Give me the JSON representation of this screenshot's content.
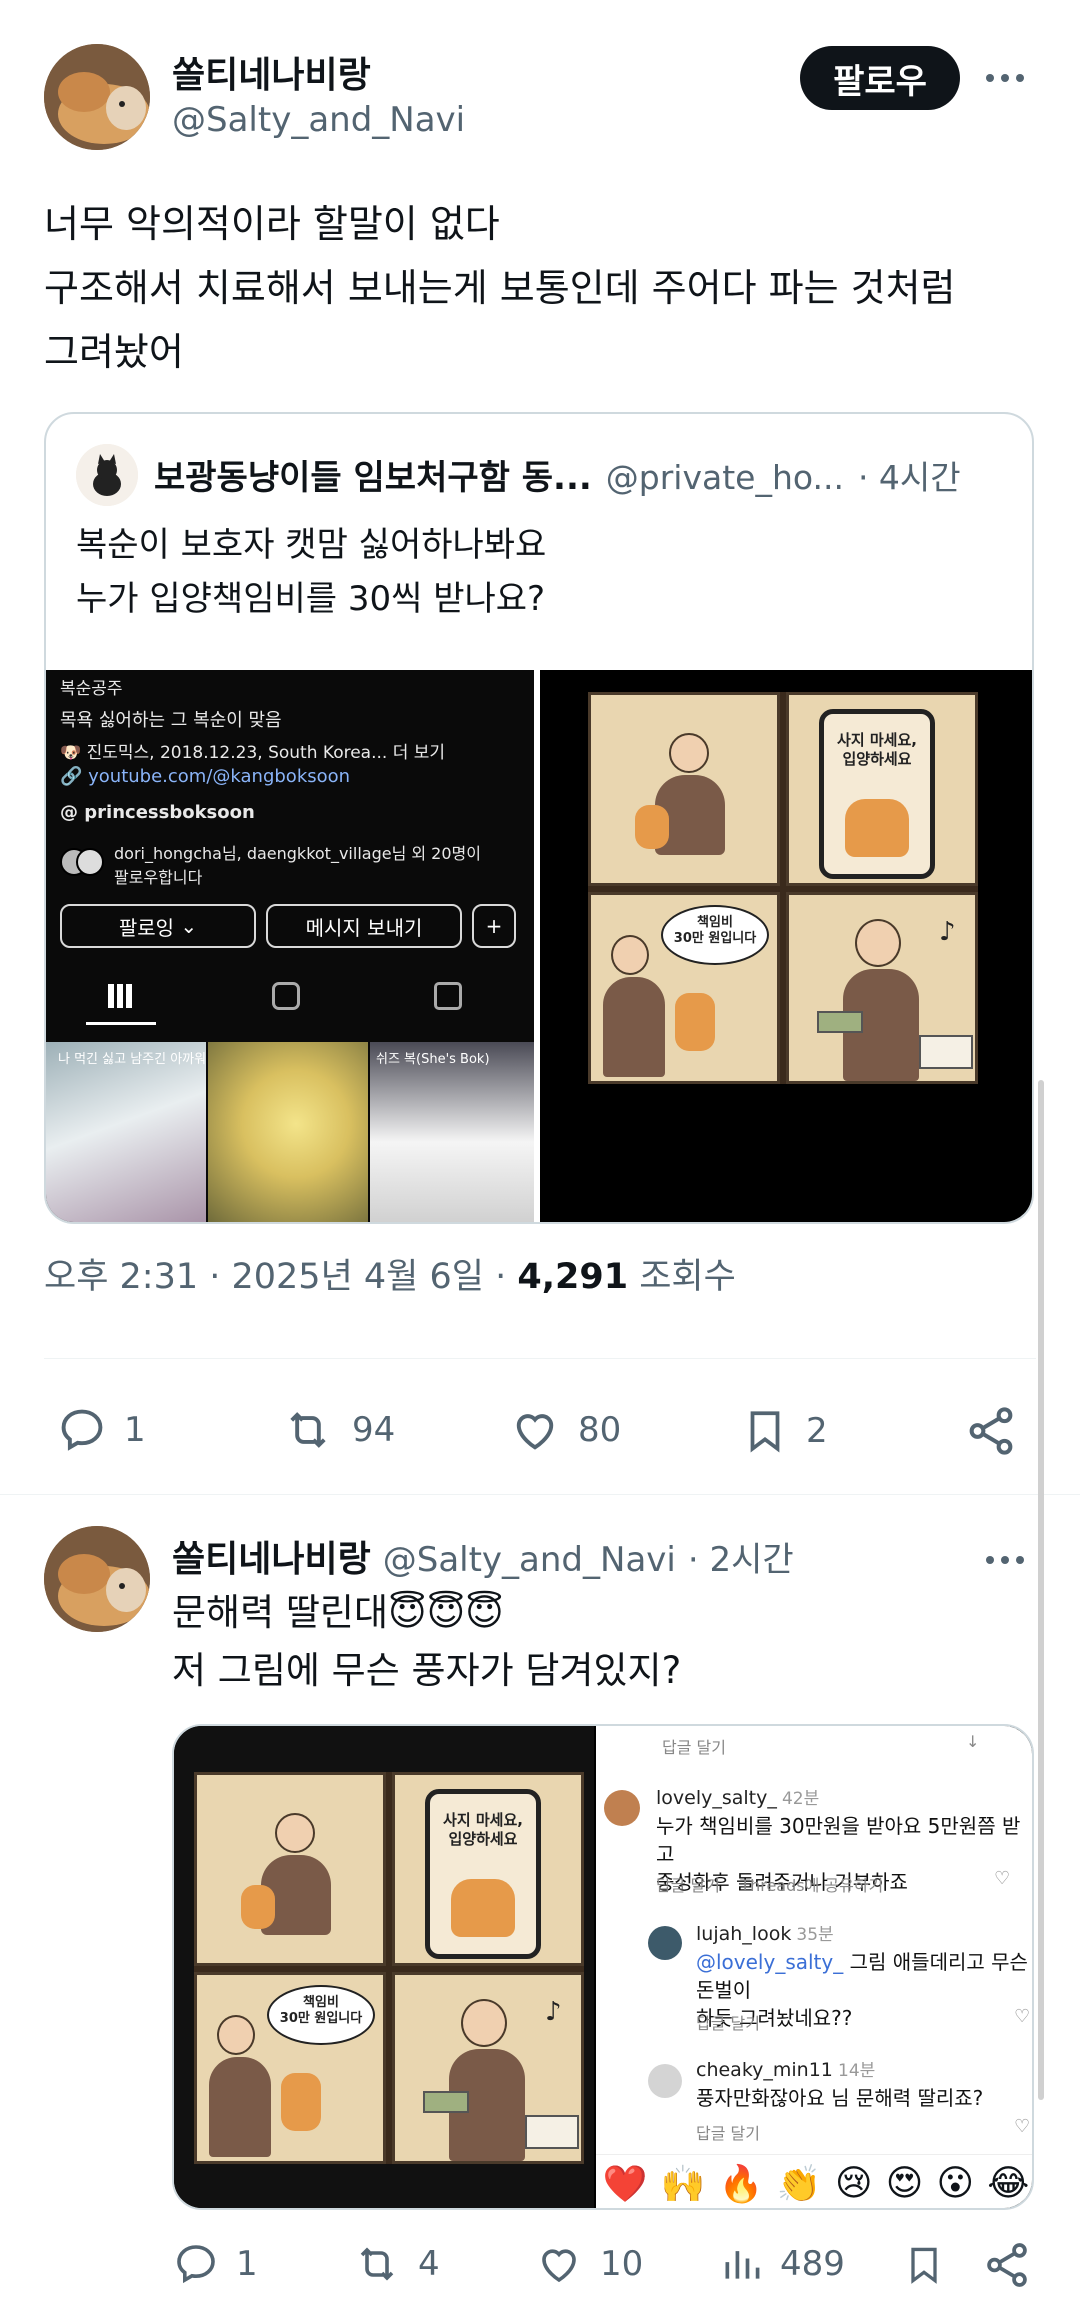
{
  "main_post": {
    "display_name": "쏠티네나비랑",
    "handle": "@Salty_and_Navi",
    "follow_label": "팔로우",
    "text_lines": [
      "너무 악의적이라 할말이 없다",
      "구조해서 치료해서 보내는게 보통인데 주어다 파는 것처럼",
      "그려놨어"
    ],
    "timestamp": "오후 2:31 · 2025년 4월 6일 · ",
    "views_count": "4,291",
    "views_label": " 조회수",
    "actions": {
      "replies": "1",
      "reposts": "94",
      "likes": "80",
      "bookmarks": "2"
    }
  },
  "quoted_post": {
    "display_name": "보광동냥이들 임보처구함 동...",
    "handle": "@private_ho...",
    "time": "· 4시간",
    "text_lines": [
      "복순이 보호자 캣맘 싫어하나봐요",
      "누가 입양책임비를 30씩 받나요?"
    ],
    "ig_profile": {
      "name": "복순공주",
      "bio": "목욕 싫어하는 그 복순이 맞음",
      "info": "🐶 진도믹스, 2018.12.23, South Korea... 더 보기",
      "link": "youtube.com/@kangboksoon",
      "threads": "princessboksoon",
      "followed_by_names": "dori_hongcha님, daengkkot_village님 외 20명이",
      "followed_by_suffix": "팔로우합니다",
      "following_btn": "팔로잉",
      "message_btn": "메시지 보내기",
      "thumb_captions": [
        "나 먹긴 싫고 남주긴 아까워",
        "",
        "쉬즈 복(She's Bok)"
      ]
    }
  },
  "comic": {
    "panel_phone": "사지 마세요,\n입양하세요",
    "panel_bubble": "책임비\n30만 원입니다"
  },
  "reply_post": {
    "display_name": "쏠티네나비랑",
    "handle": "@Salty_and_Navi",
    "time": "· 2시간",
    "text_lines": [
      "문해력 딸린대",
      "저 그림에 무슨 풍자가 담겨있지?"
    ],
    "emoji": "😇😇😇",
    "comments": [
      {
        "name": "",
        "time": "",
        "body": "",
        "actions": "답글 달기"
      },
      {
        "name": "lovely_salty_",
        "time": "42분",
        "body": "누가 책임비를 30만원을 받아요 5만원쯤 받고\n중성화후 돌려주거나 기부하죠",
        "actions": "답글 달기    Threads에 공유하기"
      },
      {
        "name": "lujah_look",
        "time": "35분",
        "mention": "@lovely_salty_",
        "body": " 그림 애들데리고 무슨 돈벌이\n하듯 그려놨네요??",
        "actions": "답글 달기"
      },
      {
        "name": "cheaky_min11",
        "time": "14분",
        "body": "풍자만화잖아요 님 문해력 딸리죠?",
        "actions": "답글 달기"
      }
    ],
    "reaction_emojis": [
      "❤️",
      "🙌",
      "🔥",
      "👏",
      "😢",
      "😍",
      "😮",
      "😂"
    ],
    "actions": {
      "replies": "1",
      "reposts": "4",
      "likes": "10",
      "views": "489"
    }
  },
  "colors": {
    "text": "#0f1419",
    "muted": "#536471",
    "link": "#1d9bf0",
    "ig_link": "#8ab4f8"
  }
}
